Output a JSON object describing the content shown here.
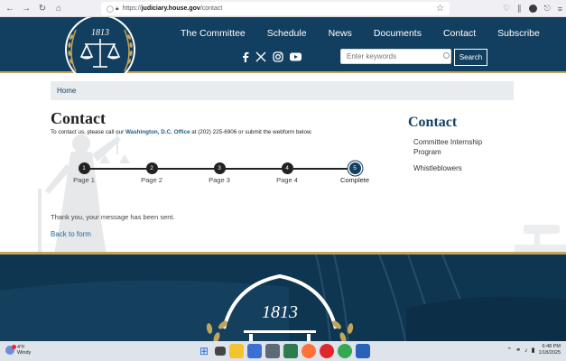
{
  "browser": {
    "url_prefix": "https://",
    "url_domain": "judiciary.house.gov",
    "url_path": "/contact"
  },
  "header": {
    "logo_year": "1813",
    "nav": [
      "The Committee",
      "Schedule",
      "News",
      "Documents",
      "Contact",
      "Subscribe"
    ],
    "search_placeholder": "Enter keywords",
    "search_button": "Search",
    "social": [
      "facebook-icon",
      "x-icon",
      "instagram-icon",
      "youtube-icon"
    ]
  },
  "breadcrumb": {
    "home": "Home"
  },
  "main": {
    "title": "Contact",
    "intro_before": "To contact us, please call our ",
    "intro_link": "Washington, D.C. Office",
    "intro_after": " at (202) 225-6906 or submit the webform below.",
    "steps": [
      {
        "num": "1",
        "label": "Page 1"
      },
      {
        "num": "2",
        "label": "Page 2"
      },
      {
        "num": "3",
        "label": "Page 3"
      },
      {
        "num": "4",
        "label": "Page 4"
      },
      {
        "num": "5",
        "label": "Complete"
      }
    ],
    "active_step": 5,
    "message": "Thank you, your message has been sent.",
    "back_link": "Back to form"
  },
  "aside": {
    "title": "Contact",
    "links": [
      "Committee Internship Program",
      "Whistleblowers"
    ]
  },
  "footer": {
    "logo_year": "1813"
  },
  "taskbar": {
    "temperature": "4°F",
    "condition": "Windy",
    "time": "6:48 PM",
    "date": "1/18/2025"
  },
  "colors": {
    "header_bg": "#123f5f",
    "gold": "#c4a35a",
    "link": "#1d5b86"
  }
}
